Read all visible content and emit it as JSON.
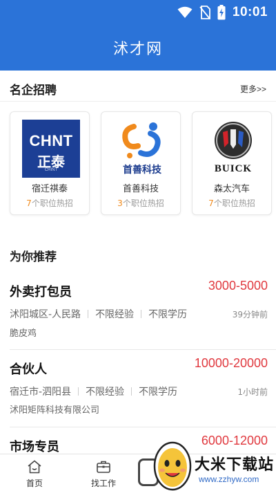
{
  "status_bar": {
    "time": "10:01"
  },
  "app_bar": {
    "title": "沭才网"
  },
  "featured": {
    "title": "名企招聘",
    "more_label": "更多>>",
    "companies": [
      {
        "name": "宿迁祺泰",
        "jobs_count": "7",
        "jobs_suffix": "个职位热招",
        "logo_top": "CHNT",
        "logo_bottom": "正泰",
        "logo_tiny": "CHINT"
      },
      {
        "name": "首善科技",
        "jobs_count": "3",
        "jobs_suffix": "个职位热招",
        "logo_text": "首善科技"
      },
      {
        "name": "森太汽车",
        "jobs_count": "7",
        "jobs_suffix": "个职位热招",
        "logo_text": "BUICK"
      }
    ]
  },
  "recommend": {
    "title": "为你推荐",
    "jobs": [
      {
        "title": "外卖打包员",
        "salary": "3000-5000",
        "location": "沭阳城区-人民路",
        "experience": "不限经验",
        "education": "不限学历",
        "time": "39分钟前",
        "company": "脆皮鸡"
      },
      {
        "title": "合伙人",
        "salary": "10000-20000",
        "location": "宿迁市-泗阳县",
        "experience": "不限经验",
        "education": "不限学历",
        "time": "1小时前",
        "company": "沭阳矩阵科技有限公司"
      },
      {
        "title": "市场专员",
        "salary": "6000-12000"
      }
    ]
  },
  "bottom_nav": {
    "items": [
      {
        "label": "首页",
        "icon": "home-icon"
      },
      {
        "label": "找工作",
        "icon": "briefcase-icon"
      }
    ]
  },
  "watermark": {
    "text": "大米下载站",
    "url": "www.zzhyw.com"
  },
  "colors": {
    "primary": "#2b73d8",
    "salary": "#e0383e",
    "highlight": "#f08a1c"
  }
}
